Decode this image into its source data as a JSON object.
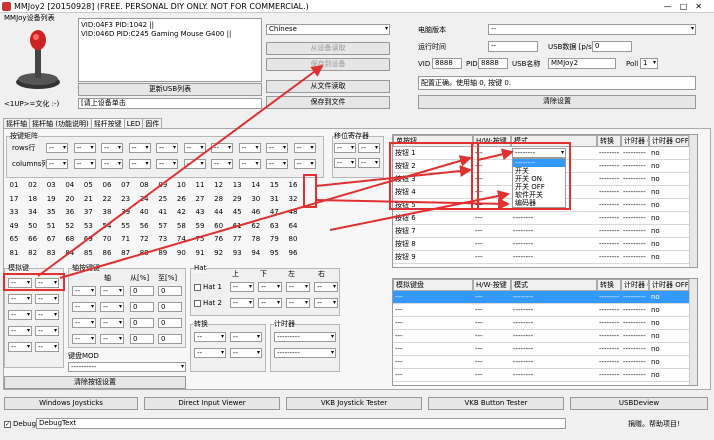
{
  "window": {
    "title": "MMJoy2 [20150928] (FREE. PERSONAL DIY ONLY. NOT FOR COMMERCIAL.)"
  },
  "device_list": {
    "label": "MMJoy设备列表",
    "items": [
      "VID:04F3 PID:1042  ||",
      "VID:046D PID:C245 Gaming Mouse G400 ||"
    ],
    "refresh_label": "更新USB列表",
    "hint_label": "<1UP>=文化 :-)",
    "hint_input": "[请上设备单击"
  },
  "language": {
    "value": "Chinese"
  },
  "settings_buttons": {
    "read_device": "从设备读取",
    "save_device": "保存到设备",
    "read_file": "从文件读取",
    "save_file": "保存到文件"
  },
  "hw": {
    "version_label": "电脑版本",
    "version_value": "--",
    "runtime_label": "运行时间",
    "runtime_value": "--",
    "usb_data_label": "USB数据 [p/s]",
    "usb_data_value": "0",
    "vid_label": "VID",
    "vid_value": "8888",
    "pid_label": "PID",
    "pid_value": "8888",
    "usbname_label": "USB名称",
    "usbname_value": "MMJoy2",
    "poll_label": "Poll",
    "poll_value": "1",
    "status_text": "配置正确。使用轴 0, 按键 0.",
    "clear_label": "清除设置"
  },
  "tabs": [
    "摇杆轴",
    "摇杆轴 (功能说明)",
    "摇杆按键",
    "LED",
    "固件"
  ],
  "matrix": {
    "group_label": "按键矩阵",
    "rows_label": "rows行",
    "cols_label": "columns列",
    "shift_label": "移位寄存器"
  },
  "numbers": [
    "01",
    "02",
    "03",
    "04",
    "05",
    "06",
    "07",
    "08",
    "09",
    "10",
    "11",
    "12",
    "13",
    "14",
    "15",
    "16",
    "17",
    "18",
    "19",
    "20",
    "21",
    "22",
    "23",
    "24",
    "25",
    "26",
    "27",
    "28",
    "29",
    "30",
    "31",
    "32",
    "33",
    "34",
    "35",
    "36",
    "37",
    "38",
    "39",
    "40",
    "41",
    "42",
    "43",
    "44",
    "45",
    "46",
    "47",
    "48",
    "49",
    "50",
    "51",
    "52",
    "53",
    "54",
    "55",
    "56",
    "57",
    "58",
    "59",
    "60",
    "61",
    "62",
    "63",
    "64",
    "65",
    "66",
    "67",
    "68",
    "69",
    "70",
    "71",
    "72",
    "73",
    "74",
    "75",
    "76",
    "77",
    "78",
    "79",
    "80",
    "81",
    "82",
    "83",
    "84",
    "85",
    "86",
    "87",
    "88",
    "89",
    "90",
    "91",
    "92",
    "93",
    "94",
    "95",
    "96"
  ],
  "bottom_groups": {
    "mode_label": "模拟键",
    "axis_buttons_label": "轴按键键",
    "axis_col": "轴",
    "from_col": "从[%]",
    "to_col": "至[%]",
    "from_values": [
      "0",
      "0",
      "0",
      "0"
    ],
    "to_values": [
      "0",
      "0",
      "0",
      "0"
    ],
    "hat_label": "Hat",
    "hat_dirs": [
      "上",
      "下",
      "左",
      "右"
    ],
    "hat1": "Hat 1",
    "hat2": "Hat 2",
    "convert_label": "转换",
    "timer_label": "计时器",
    "keyboard_mod_label": "键盘MOD",
    "reset_label": "清除按钮设置"
  },
  "button_table": {
    "headers": [
      "单按钮",
      "H/W-按键",
      "模式",
      "转换",
      "计时器 ON",
      "计时器 OFF"
    ],
    "rows": [
      {
        "name": "按钮 1",
        "hw": "---",
        "mode": "--------",
        "conv": "--------",
        "on": "---------",
        "off": "no"
      },
      {
        "name": "按钮 2",
        "hw": "---",
        "mode": "",
        "conv": "--------",
        "on": "---------",
        "off": "no"
      },
      {
        "name": "按钮 3",
        "hw": "---",
        "mode": "",
        "conv": "--------",
        "on": "---------",
        "off": "no"
      },
      {
        "name": "按钮 4",
        "hw": "---",
        "mode": "",
        "conv": "--------",
        "on": "---------",
        "off": "no"
      },
      {
        "name": "按钮 5",
        "hw": "---",
        "mode": "",
        "conv": "--------",
        "on": "---------",
        "off": "no"
      },
      {
        "name": "按钮 6",
        "hw": "---",
        "mode": "--------",
        "conv": "--------",
        "on": "---------",
        "off": "no"
      },
      {
        "name": "按钮 7",
        "hw": "---",
        "mode": "--------",
        "conv": "--------",
        "on": "---------",
        "off": "no"
      },
      {
        "name": "按钮 8",
        "hw": "---",
        "mode": "--------",
        "conv": "--------",
        "on": "---------",
        "off": "no"
      },
      {
        "name": "按钮 9",
        "hw": "---",
        "mode": "--------",
        "conv": "--------",
        "on": "---------",
        "off": "no"
      }
    ],
    "dropdown_value": "--------",
    "dropdown_options": [
      "--------",
      "开关",
      "开关 ON",
      "开关 OFF",
      "软件开关",
      "编码器"
    ]
  },
  "keyboard_table": {
    "headers": [
      "模拟键盘",
      "H/W-按键",
      "模式",
      "转换",
      "计时器 ON",
      "计时器 OFF"
    ],
    "rows": [
      {
        "name": "---",
        "hw": "---",
        "mode": "--------",
        "conv": "--------",
        "on": "---------",
        "off": "no"
      },
      {
        "name": "---",
        "hw": "---",
        "mode": "--------",
        "conv": "--------",
        "on": "---------",
        "off": "no"
      },
      {
        "name": "---",
        "hw": "---",
        "mode": "--------",
        "conv": "--------",
        "on": "---------",
        "off": "no"
      },
      {
        "name": "---",
        "hw": "---",
        "mode": "--------",
        "conv": "--------",
        "on": "---------",
        "off": "no"
      },
      {
        "name": "---",
        "hw": "---",
        "mode": "--------",
        "conv": "--------",
        "on": "---------",
        "off": "no"
      },
      {
        "name": "---",
        "hw": "---",
        "mode": "--------",
        "conv": "--------",
        "on": "---------",
        "off": "no"
      },
      {
        "name": "---",
        "hw": "---",
        "mode": "--------",
        "conv": "--------",
        "on": "---------",
        "off": "no"
      }
    ]
  },
  "footer_buttons": [
    "Windows Joysticks",
    "Direct Input Viewer",
    "VKB Joystick Tester",
    "VKB Button Tester",
    "USBDeview"
  ],
  "debug": {
    "label": "Debug",
    "value": "DebugText",
    "help": "捐赠。帮助项目!"
  },
  "colors": {
    "annotation": "#e03030",
    "selection": "#3399ff"
  }
}
